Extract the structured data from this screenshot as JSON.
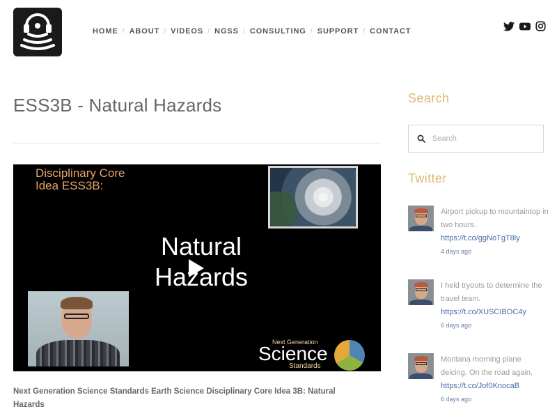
{
  "header": {
    "nav": [
      {
        "label": "HOME"
      },
      {
        "label": "ABOUT"
      },
      {
        "label": "VIDEOS"
      },
      {
        "label": "NGSS"
      },
      {
        "label": "CONSULTING"
      },
      {
        "label": "SUPPORT"
      },
      {
        "label": "CONTACT"
      }
    ],
    "social": [
      "twitter-icon",
      "youtube-icon",
      "instagram-icon"
    ]
  },
  "main": {
    "title": "ESS3B - Natural Hazards",
    "video": {
      "overlay_line1": "Disciplinary Core",
      "overlay_line2": "Idea ESS3B:",
      "title_line1": "Natural",
      "title_line2": "Hazards",
      "logo_top": "Next Generation",
      "logo_main": "Science",
      "logo_bottom": "Standards"
    },
    "caption": "Next Generation Science Standards Earth Science Disciplinary Core Idea 3B:  Natural Hazards"
  },
  "sidebar": {
    "search": {
      "title": "Search",
      "placeholder": "Search"
    },
    "twitter": {
      "title": "Twitter",
      "tweets": [
        {
          "text": "Airport pickup to mountaintop in two hours.",
          "link": "https://t.co/ggNoTgT8ly",
          "time": "4 days ago"
        },
        {
          "text": "I held tryouts to determine the travel team.",
          "link": "https://t.co/XUSCIBOC4y",
          "time": "6 days ago"
        },
        {
          "text": "Montana morning plane deicing. On the road again.",
          "link": "https://t.co/Jof0KnocaB",
          "time": "6 days ago"
        }
      ]
    }
  },
  "colors": {
    "accent": "#e0b870",
    "link": "#4a6aa5",
    "text": "#666666"
  }
}
